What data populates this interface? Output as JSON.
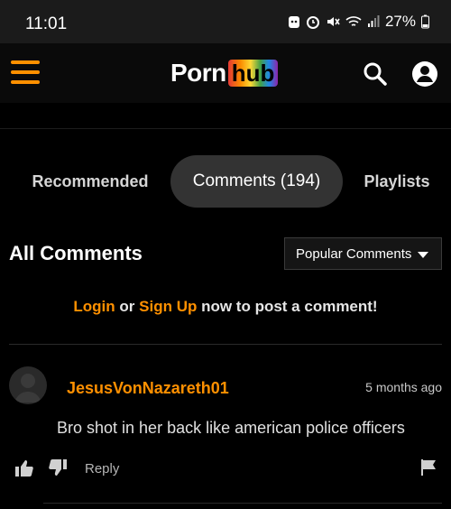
{
  "status_bar": {
    "time": "11:01",
    "battery": "27%",
    "icons": [
      "notification-icon",
      "alarm-icon",
      "mute-icon",
      "wifi-icon",
      "signal-icon",
      "battery-icon"
    ]
  },
  "header": {
    "logo_left": "Porn",
    "logo_right": "hub",
    "icons": [
      "menu-icon",
      "search-icon",
      "user-icon"
    ],
    "accent_color": "#ff9000"
  },
  "tabs": [
    {
      "label": "Recommended",
      "active": false
    },
    {
      "label": "Comments (194)",
      "active": true
    },
    {
      "label": "Playlists",
      "active": false
    }
  ],
  "comments_section": {
    "heading": "All Comments",
    "sort_selected": "Popular Comments",
    "login_prompt": {
      "login": "Login",
      "or": "or",
      "signup": "Sign Up",
      "rest": "now to post a comment!"
    }
  },
  "comments": [
    {
      "username": "JesusVonNazareth01",
      "time": "5 months ago",
      "text": "Bro shot in her back like american police officers",
      "reply_label": "Reply"
    }
  ]
}
